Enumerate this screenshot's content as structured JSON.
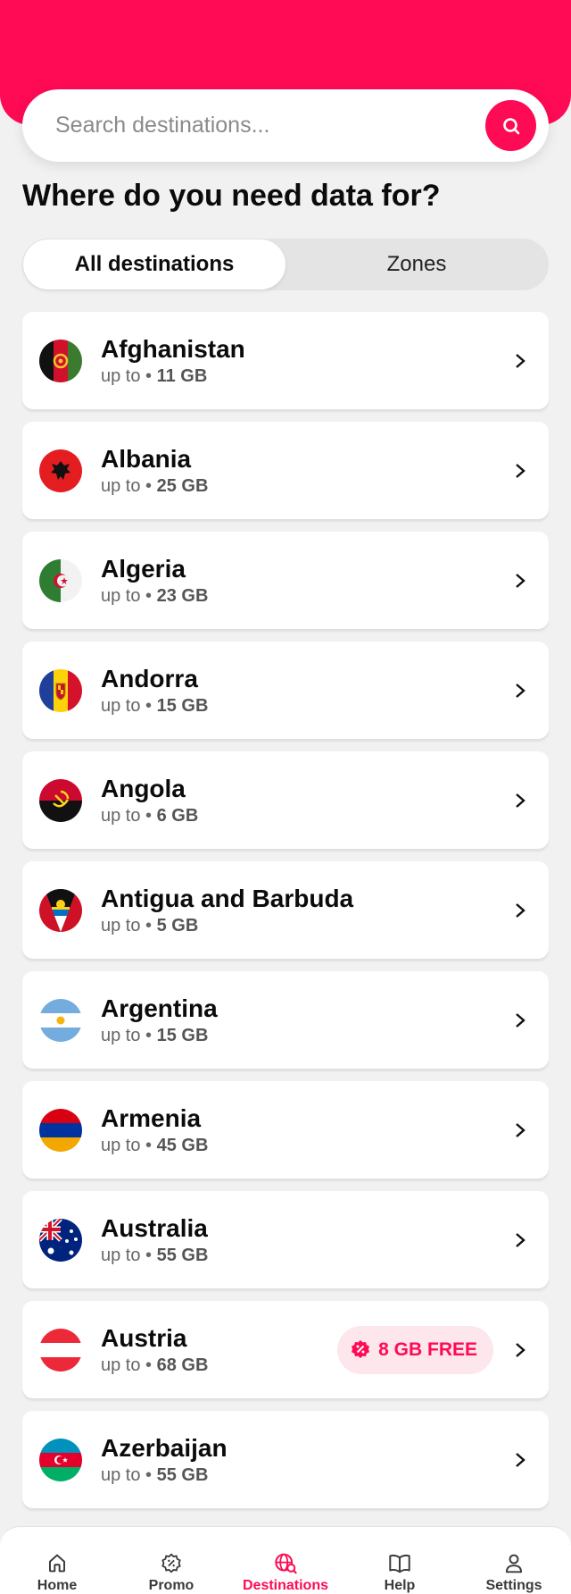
{
  "colors": {
    "accent": "#ff0a54",
    "background": "#f1f1f1",
    "badge_bg": "#fde6ec"
  },
  "search": {
    "placeholder": "Search destinations..."
  },
  "page_title": "Where do you need data for?",
  "tabs": [
    {
      "label": "All destinations",
      "active": true
    },
    {
      "label": "Zones",
      "active": false
    }
  ],
  "up_to_label": "up to",
  "destinations": [
    {
      "name": "Afghanistan",
      "data": "11 GB",
      "flag": "afghanistan-flag-icon"
    },
    {
      "name": "Albania",
      "data": "25 GB",
      "flag": "albania-flag-icon"
    },
    {
      "name": "Algeria",
      "data": "23 GB",
      "flag": "algeria-flag-icon"
    },
    {
      "name": "Andorra",
      "data": "15 GB",
      "flag": "andorra-flag-icon"
    },
    {
      "name": "Angola",
      "data": "6 GB",
      "flag": "angola-flag-icon"
    },
    {
      "name": "Antigua and Barbuda",
      "data": "5 GB",
      "flag": "antigua-flag-icon"
    },
    {
      "name": "Argentina",
      "data": "15 GB",
      "flag": "argentina-flag-icon"
    },
    {
      "name": "Armenia",
      "data": "45 GB",
      "flag": "armenia-flag-icon"
    },
    {
      "name": "Australia",
      "data": "55 GB",
      "flag": "australia-flag-icon"
    },
    {
      "name": "Austria",
      "data": "68 GB",
      "flag": "austria-flag-icon",
      "badge": "8 GB FREE"
    },
    {
      "name": "Azerbaijan",
      "data": "55 GB",
      "flag": "azerbaijan-flag-icon"
    }
  ],
  "bottom_nav": [
    {
      "label": "Home",
      "icon": "home-icon",
      "active": false
    },
    {
      "label": "Promo",
      "icon": "promo-icon",
      "active": false
    },
    {
      "label": "Destinations",
      "icon": "globe-search-icon",
      "active": true
    },
    {
      "label": "Help",
      "icon": "book-icon",
      "active": false
    },
    {
      "label": "Settings",
      "icon": "user-icon",
      "active": false
    }
  ]
}
